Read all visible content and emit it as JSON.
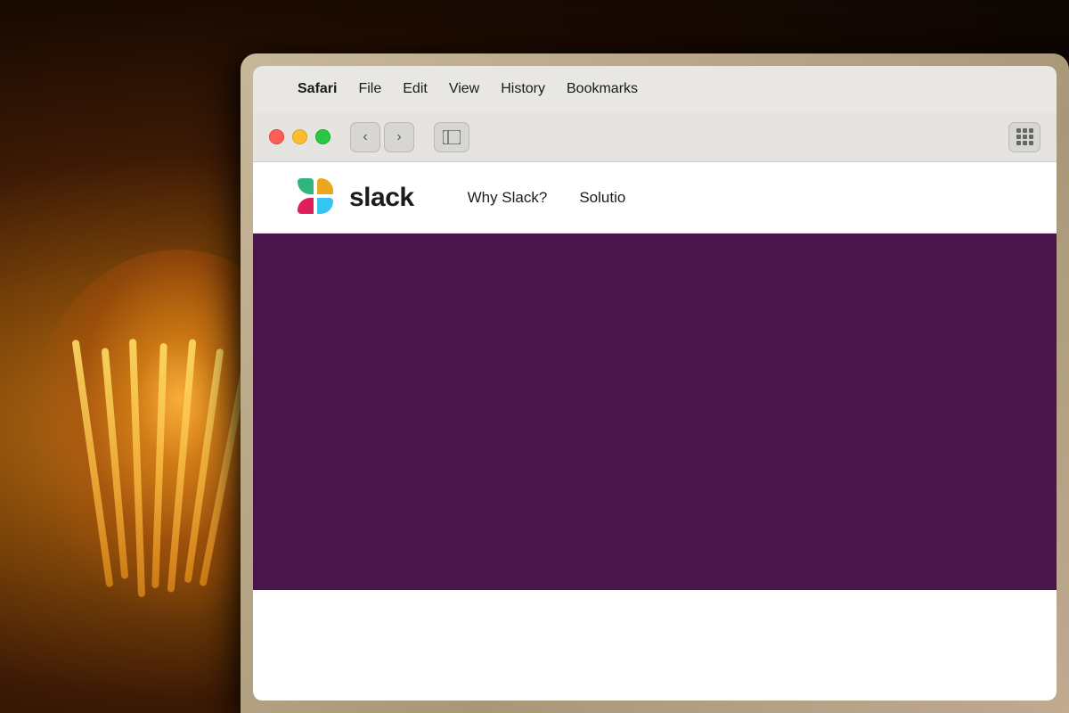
{
  "background": {
    "color": "#1a0e06"
  },
  "menubar": {
    "apple_symbol": "",
    "items": [
      {
        "label": "Safari",
        "active": true
      },
      {
        "label": "File",
        "active": false
      },
      {
        "label": "Edit",
        "active": false
      },
      {
        "label": "View",
        "active": false
      },
      {
        "label": "History",
        "active": false
      },
      {
        "label": "Bookmarks",
        "active": false
      }
    ]
  },
  "toolbar": {
    "back_label": "‹",
    "forward_label": "›",
    "sidebar_icon": "⊞",
    "grid_icon": "grid"
  },
  "slack_nav": {
    "wordmark": "slack",
    "links": [
      {
        "label": "Why Slack?"
      },
      {
        "label": "Solutio"
      }
    ]
  },
  "colors": {
    "slack_purple": "#4a154b",
    "slack_green": "#2fb67c",
    "slack_yellow": "#e9a820",
    "slack_red": "#e01e5a",
    "slack_blue": "#36c5f0",
    "mac_bg": "#ebe9e6",
    "traffic_red": "#ff5f57",
    "traffic_yellow": "#ffbd2e",
    "traffic_green": "#28c840"
  }
}
